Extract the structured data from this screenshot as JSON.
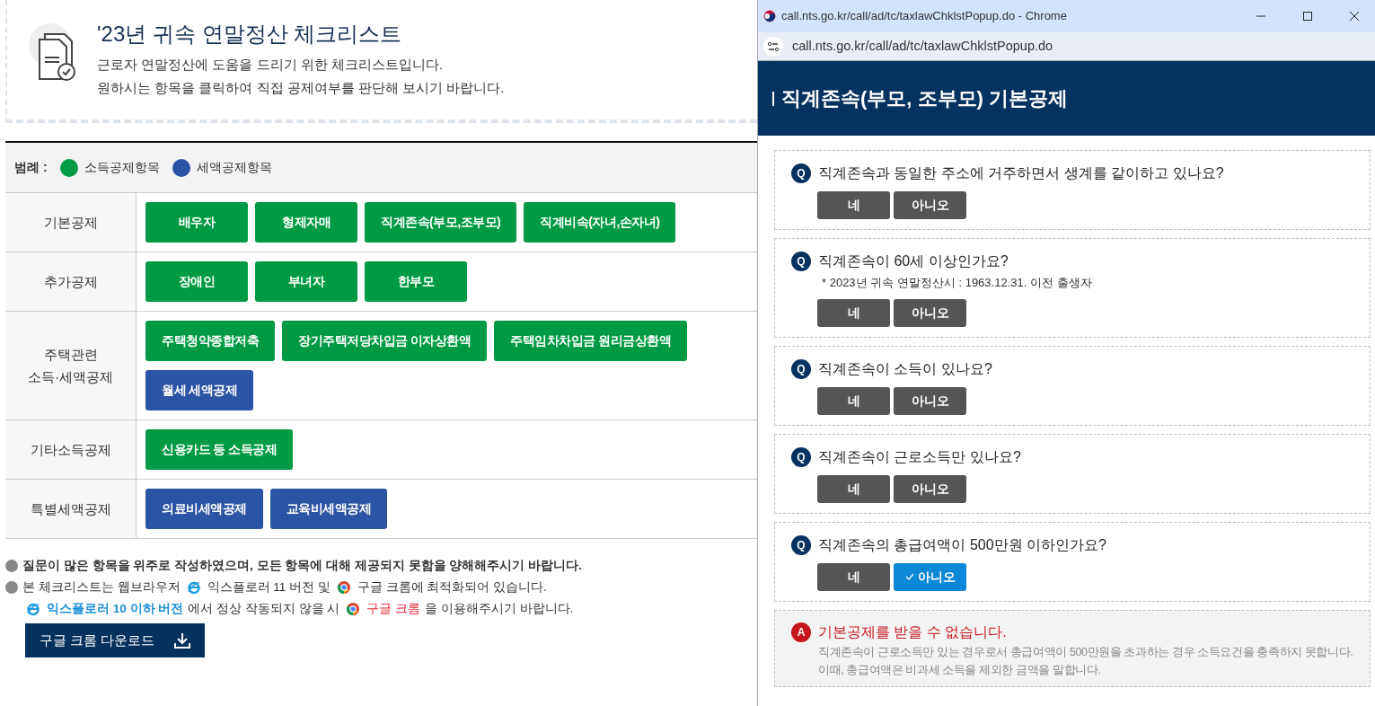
{
  "header": {
    "title": "'23년 귀속 연말정산 체크리스트",
    "lines": [
      "근로자 연말정산에 도움을 드리기 위한 체크리스트입니다.",
      "원하시는 항목을 클릭하여 직접 공제여부를 판단해 보시기 바랍니다."
    ]
  },
  "legend": {
    "label": "범례 :",
    "items": [
      {
        "text": "소득공제항목",
        "color": "#009a44"
      },
      {
        "text": "세액공제항목",
        "color": "#2c54a4"
      }
    ]
  },
  "categories": [
    {
      "label": "기본공제",
      "items": [
        {
          "text": "배우자",
          "color": "#009a44"
        },
        {
          "text": "형제자매",
          "color": "#009a44"
        },
        {
          "text": "직계존속(부모,조부모)",
          "color": "#009a44"
        },
        {
          "text": "직계비속(자녀,손자녀)",
          "color": "#009a44"
        }
      ]
    },
    {
      "label": "추가공제",
      "items": [
        {
          "text": "장애인",
          "color": "#009a44"
        },
        {
          "text": "부녀자",
          "color": "#009a44"
        },
        {
          "text": "한부모",
          "color": "#009a44"
        }
      ]
    },
    {
      "label": "주택관련\n소득·세액공제",
      "items": [
        {
          "text": "주택청약종합저축",
          "color": "#009a44"
        },
        {
          "text": "장기주택저당차입금 이자상환액",
          "color": "#009a44"
        },
        {
          "text": "주택임차차입금 원리금상환액",
          "color": "#009a44"
        },
        {
          "text": "월세 세액공제",
          "color": "#2c54a4"
        }
      ]
    },
    {
      "label": "기타소득공제",
      "items": [
        {
          "text": "신용카드 등 소득공제",
          "color": "#009a44"
        }
      ]
    },
    {
      "label": "특별세액공제",
      "items": [
        {
          "text": "의료비세액공제",
          "color": "#2c54a4"
        },
        {
          "text": "교육비세액공제",
          "color": "#2c54a4"
        }
      ]
    }
  ],
  "notes": [
    {
      "bullet": true,
      "parts": [
        {
          "kind": "bold",
          "text": "질문이 많은 항목을 위주로 작성하였으며, 모든 항목에 대해 제공되지 못함을 양해해주시기 바랍니다."
        }
      ]
    },
    {
      "bullet": true,
      "parts": [
        {
          "kind": "text",
          "text": "본 체크리스트는 웹브라우저"
        },
        {
          "kind": "ie"
        },
        {
          "kind": "text",
          "text": "익스플로러 11 버전 및"
        },
        {
          "kind": "chrome"
        },
        {
          "kind": "text",
          "text": "구글 크롬에 최적화되어 있습니다."
        }
      ]
    },
    {
      "bullet": false,
      "parts": [
        {
          "kind": "ie"
        },
        {
          "kind": "ie-link",
          "text": "익스플로러 10 이하 버전"
        },
        {
          "kind": "text",
          "text": "에서 정상 작동되지 않을 시"
        },
        {
          "kind": "chrome"
        },
        {
          "kind": "chrome-link",
          "text": "구글 크롬"
        },
        {
          "kind": "text",
          "text": "을 이용해주시기 바랍니다."
        }
      ]
    }
  ],
  "download_button": "구글 크롬 다운로드",
  "popup": {
    "window_title": "call.nts.go.kr/call/ad/tc/taxlawChklstPopup.do - Chrome",
    "url": "call.nts.go.kr/call/ad/tc/taxlawChklstPopup.do",
    "heading": "직계존속(부모, 조부모) 기본공제",
    "questions": [
      {
        "mark": "Q",
        "text": "직계존속과 동일한 주소에 거주하면서 생계를 같이하고 있나요?",
        "answers": [
          {
            "text": "네",
            "selected": false
          },
          {
            "text": "아니오",
            "selected": false
          }
        ]
      },
      {
        "mark": "Q",
        "text": "직계존속이 60세 이상인가요?",
        "note": "* 2023년 귀속 연말정산시 : 1963.12.31. 이전 출생자",
        "answers": [
          {
            "text": "네",
            "selected": false
          },
          {
            "text": "아니오",
            "selected": false
          }
        ]
      },
      {
        "mark": "Q",
        "text": "직계존속이 소득이 있나요?",
        "answers": [
          {
            "text": "네",
            "selected": false
          },
          {
            "text": "아니오",
            "selected": false
          }
        ]
      },
      {
        "mark": "Q",
        "text": "직계존속이 근로소득만 있나요?",
        "answers": [
          {
            "text": "네",
            "selected": false
          },
          {
            "text": "아니오",
            "selected": false
          }
        ]
      },
      {
        "mark": "Q",
        "text": "직계존속의 총급여액이 500만원 이하인가요?",
        "answers": [
          {
            "text": "네",
            "selected": false
          },
          {
            "text": "아니오",
            "selected": true
          }
        ]
      }
    ],
    "result": {
      "mark": "A",
      "title": "기본공제를 받을 수 없습니다.",
      "lines": [
        "직계존속이 근로소득만 있는 경우로서 총급여액이 500만원을 초과하는 경우 소득요건을 충족하지 못합니다.",
        "이때, 총급여액은 비과세 소득을 제외한 금액을 말합니다."
      ]
    }
  }
}
